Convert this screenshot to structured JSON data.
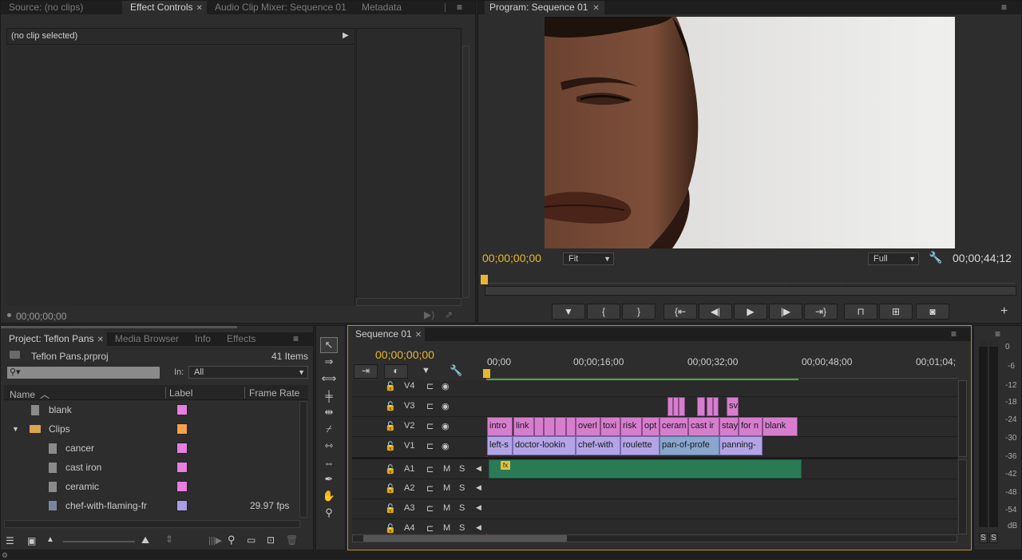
{
  "source_panel": {
    "tabs": [
      {
        "label": "Source: (no clips)"
      },
      {
        "label": "Effect Controls"
      },
      {
        "label": "Audio Clip Mixer: Sequence 01"
      },
      {
        "label": "Metadata"
      }
    ],
    "no_clip_text": "(no clip selected)",
    "timecode": "00;00;00;00"
  },
  "program_panel": {
    "tab_label": "Program: Sequence 01",
    "timecode_left": "00;00;00;00",
    "timecode_right": "00;00;44;12",
    "zoom_value": "Fit",
    "quality_value": "Full"
  },
  "project_panel": {
    "tabs": [
      {
        "label": "Project: Teflon Pans"
      },
      {
        "label": "Media Browser"
      },
      {
        "label": "Info"
      },
      {
        "label": "Effects"
      }
    ],
    "project_file": "Teflon Pans.prproj",
    "item_count": "41 Items",
    "in_label": "In:",
    "in_value": "All",
    "columns": {
      "name": "Name",
      "label": "Label",
      "frame_rate": "Frame Rate"
    },
    "items": [
      {
        "name": "blank",
        "color": "#e87ee0",
        "fps": "",
        "type": "file"
      },
      {
        "name": "Clips",
        "color": "#f2a34a",
        "fps": "",
        "type": "folder"
      },
      {
        "name": "cancer",
        "color": "#e87ee0",
        "fps": "",
        "type": "file"
      },
      {
        "name": "cast iron",
        "color": "#e87ee0",
        "fps": "",
        "type": "file"
      },
      {
        "name": "ceramic",
        "color": "#e87ee0",
        "fps": "",
        "type": "file"
      },
      {
        "name": "chef-with-flaming-fr",
        "color": "#a99ee8",
        "fps": "29.97 fps",
        "type": "video"
      }
    ]
  },
  "timeline": {
    "tab_label": "Sequence 01",
    "timecode": "00;00;00;00",
    "ruler_labels": [
      "00;00",
      "00;00;16;00",
      "00;00;32;00",
      "00;00;48;00",
      "00;01;04;"
    ],
    "video_tracks": [
      "V4",
      "V3",
      "V2",
      "V1"
    ],
    "audio_tracks": [
      "A1",
      "A2",
      "A3",
      "A4"
    ],
    "track_m": "M",
    "track_s": "S",
    "v3_clip": "sv",
    "v2_clips": [
      "intro",
      "link",
      "",
      "",
      "",
      "",
      "overl",
      "toxi",
      "risk",
      "opt",
      "ceram",
      "cast ir",
      "stay",
      "for n",
      "blank"
    ],
    "v1_clips": [
      "left-s",
      "doctor-lookin",
      "chef-with",
      "roulette",
      "pan-of-profe",
      "panning-"
    ],
    "fx_badge": "fx"
  },
  "audio_meter": {
    "scale": [
      "0",
      "-6",
      "-12",
      "-18",
      "-24",
      "-30",
      "-36",
      "-42",
      "-48",
      "-54",
      "dB"
    ],
    "solo": [
      "S",
      "S"
    ]
  }
}
